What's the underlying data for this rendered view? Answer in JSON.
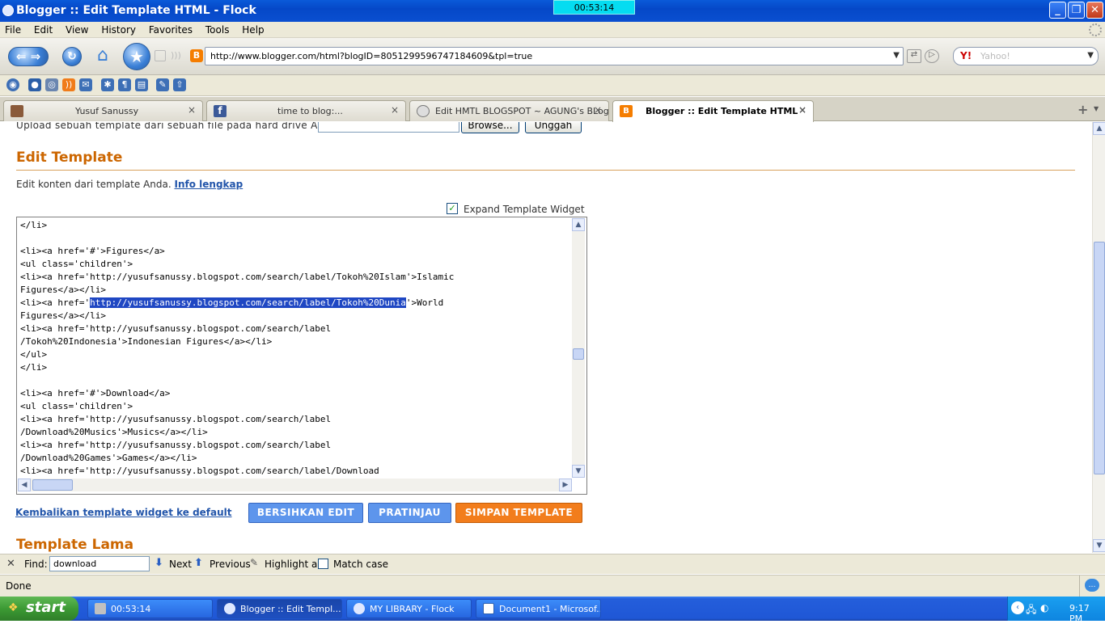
{
  "window": {
    "title": "Blogger :: Edit Template HTML - Flock",
    "timer": "00:53:14"
  },
  "menu": [
    "File",
    "Edit",
    "View",
    "History",
    "Favorites",
    "Tools",
    "Help"
  ],
  "nav": {
    "url": "http://www.blogger.com/html?blogID=8051299596747184609&tpl=true",
    "search_placeholder": "Yahoo!"
  },
  "tabs": [
    {
      "label": "Yusuf Sanussy",
      "active": false
    },
    {
      "label": "time to blog:...",
      "active": false
    },
    {
      "label": "Edit HMTL BLOGSPOT ~ AGUNG's BLog",
      "active": false
    },
    {
      "label": "Blogger :: Edit Template HTML",
      "active": true
    }
  ],
  "page": {
    "upload_text": "Upload sebuah template dari sebuah file pada hard drive Anda:",
    "browse_label": "Browse...",
    "unggah_label": "Unggah",
    "section_title": "Edit Template",
    "edit_desc": "Edit konten dari template Anda.",
    "info_link": "Info lengkap",
    "expand_label": "Expand Template Widget",
    "expand_checked": true,
    "code_lines": [
      "</li>",
      "",
      "<li><a href='#'>Figures</a>",
      "<ul class='children'>",
      "<li><a href='http://yusufsanussy.blogspot.com/search/label/Tokoh%20Islam'>Islamic",
      "Figures</a></li>",
      "<li><a href='|http://yusufsanussy.blogspot.com/search/label/Tokoh%20Dunia|'>World",
      "Figures</a></li>",
      "<li><a href='http://yusufsanussy.blogspot.com/search/label",
      "/Tokoh%20Indonesia'>Indonesian Figures</a></li>",
      "</ul>",
      "</li>",
      "",
      "<li><a href='#'>Download</a>",
      "<ul class='children'>",
      "<li><a href='http://yusufsanussy.blogspot.com/search/label",
      "/Download%20Musics'>Musics</a></li>",
      "<li><a href='http://yusufsanussy.blogspot.com/search/label",
      "/Download%20Games'>Games</a></li>",
      "<li><a href='http://yusufsanussy.blogspot.com/search/label/Download"
    ],
    "highlight": "http://yusufsanussy.blogspot.com/search/label/Tokoh%20Dunia",
    "reset_link": "Kembalikan template widget ke default",
    "btn_clear": "BERSIHKAN EDIT",
    "btn_preview": "PRATINJAU",
    "btn_save": "SIMPAN TEMPLATE",
    "old_title": "Template Lama",
    "accent": "#cc6600",
    "blue_btn": "#5d95ec",
    "orange_btn": "#f27d1c"
  },
  "find": {
    "label": "Find:",
    "value": "download",
    "next": "Next",
    "previous": "Previous",
    "highlight_all": "Highlight all",
    "match_case": "Match case"
  },
  "status": "Done",
  "taskbar": {
    "start": "start",
    "items": [
      "00:53:14",
      "Blogger :: Edit Templ...",
      "MY LIBRARY - Flock",
      "Document1 - Microsof..."
    ],
    "clock": "9:17 PM"
  }
}
